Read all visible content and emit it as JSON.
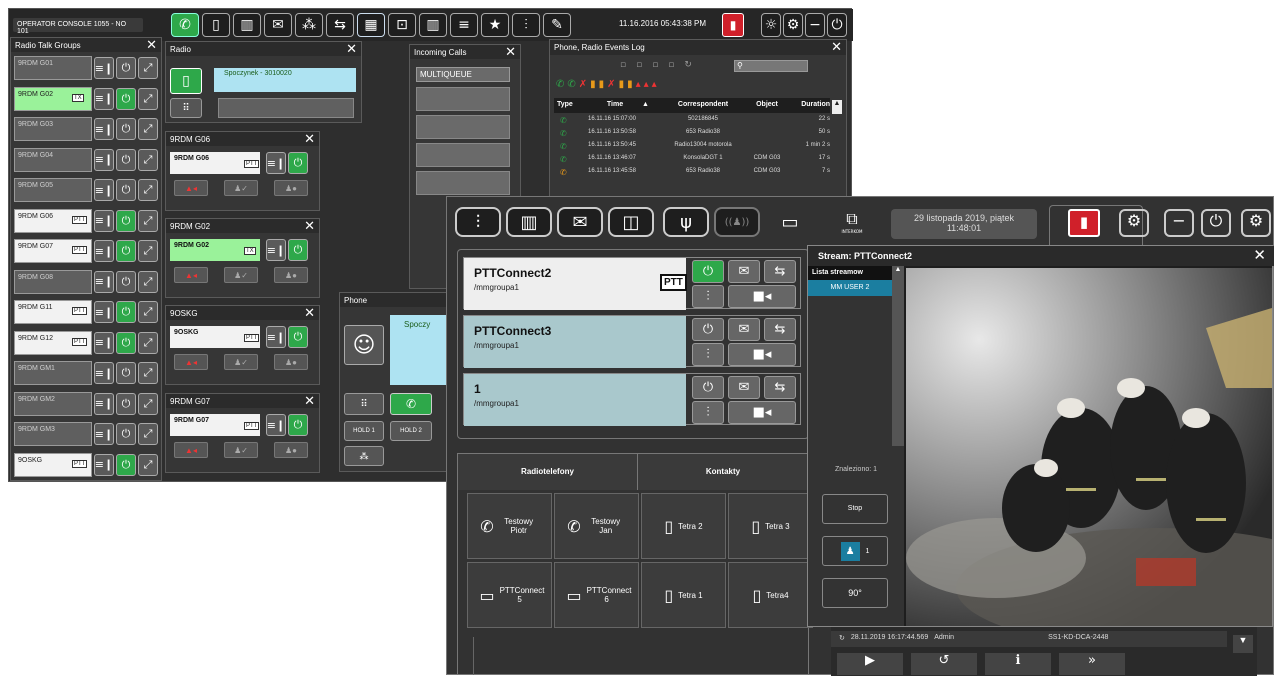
{
  "console": {
    "title": "OPERATOR CONSOLE 1055 - NO 101",
    "clock": "11.16.2016 05:43:38 PM",
    "toolbar_icons": [
      "phone-icon",
      "handset-icon",
      "building-icon",
      "mail-icon",
      "group-icon",
      "transfer-icon",
      "calendar-icon",
      "book-icon",
      "map-icon",
      "stack-icon",
      "star-icon",
      "mixer-icon",
      "wrench-icon"
    ],
    "talk_groups": {
      "title": "Radio Talk Groups",
      "items": [
        {
          "name": "9RDM G01",
          "tag": ""
        },
        {
          "name": "9RDM G02",
          "tag": "TX"
        },
        {
          "name": "9RDM G03",
          "tag": ""
        },
        {
          "name": "9RDM G04",
          "tag": ""
        },
        {
          "name": "9RDM G05",
          "tag": ""
        },
        {
          "name": "9RDM G06",
          "tag": "PTT"
        },
        {
          "name": "9RDM G07",
          "tag": "PTT"
        },
        {
          "name": "9RDM G08",
          "tag": ""
        },
        {
          "name": "9RDM G11",
          "tag": "PTT"
        },
        {
          "name": "9RDM G12",
          "tag": "PTT"
        },
        {
          "name": "9RDM GM1",
          "tag": ""
        },
        {
          "name": "9RDM GM2",
          "tag": ""
        },
        {
          "name": "9RDM GM3",
          "tag": ""
        },
        {
          "name": "9OSKG",
          "tag": "PTT"
        }
      ]
    },
    "radio": {
      "title": "Radio",
      "status": "Spoczynek - 3010020"
    },
    "sub_panels": [
      {
        "title": "9RDM G06",
        "name": "9RDM G06",
        "tag": "PTT"
      },
      {
        "title": "9RDM G02",
        "name": "9RDM G02",
        "tag": "TX"
      },
      {
        "title": "9OSKG",
        "name": "9OSKG",
        "tag": "PTT"
      },
      {
        "title": "9RDM G07",
        "name": "9RDM G07",
        "tag": "PTT"
      }
    ],
    "incoming": {
      "title": "Incoming Calls",
      "queue": "MULTIQUEUE"
    },
    "phone": {
      "title": "Phone",
      "status": "Spoczy",
      "hold1": "HOLD 1",
      "hold2": "HOLD 2"
    },
    "events": {
      "title": "Phone, Radio Events Log",
      "columns": [
        "Type",
        "Time",
        "Correspondent",
        "Object",
        "Duration"
      ],
      "rows": [
        {
          "time": "16.11.16 15:07:00",
          "corr": "502186845",
          "obj": "",
          "dur": "22 s",
          "color": "#2ea84a"
        },
        {
          "time": "16.11.16 13:50:58",
          "corr": "653 Radio38",
          "obj": "",
          "dur": "50 s",
          "color": "#2ea84a"
        },
        {
          "time": "16.11.16 13:50:45",
          "corr": "Radio13004 motorola",
          "obj": "",
          "dur": "1 min 2 s",
          "color": "#2ea84a"
        },
        {
          "time": "16.11.16 13:46:07",
          "corr": "KonsolaDGT 1",
          "obj": "CDM G03",
          "dur": "17 s",
          "color": "#2ea84a"
        },
        {
          "time": "16.11.16 13:45:58",
          "corr": "653 Radio38",
          "obj": "CDM G03",
          "dur": "7 s",
          "color": "#e89a1a"
        }
      ]
    }
  },
  "front": {
    "date": "29 listopada 2019, piątek",
    "time": "11:48:01",
    "intercom": "INTERKOM",
    "cards": [
      {
        "name": "PTTConnect2",
        "group": "/mmgroupa1",
        "ptt": "PTT"
      },
      {
        "name": "PTTConnect3",
        "group": "/mmgroupa1",
        "ptt": ""
      },
      {
        "name": "1",
        "group": "/mmgroupa1",
        "ptt": ""
      }
    ],
    "tabs": [
      "Radiotelefony",
      "Kontakty"
    ],
    "tiles": [
      {
        "label": "Testowy Piotr",
        "icon": "phone"
      },
      {
        "label": "Testowy Jan",
        "icon": "phone"
      },
      {
        "label": "Tetra 2",
        "icon": "radio"
      },
      {
        "label": "Tetra 3",
        "icon": "radio"
      },
      {
        "label": "PTTConnect 5",
        "icon": "ptt"
      },
      {
        "label": "PTTConnect 6",
        "icon": "ptt"
      },
      {
        "label": "Tetra 1",
        "icon": "radio"
      },
      {
        "label": "Tetra4",
        "icon": "radio"
      }
    ],
    "log_rows": [
      {
        "ts": "28.11.2019 16:17:44.569",
        "user": "Admin",
        "obj": "SS1-KD-DCA-2448"
      }
    ],
    "stream": {
      "title": "Stream: PTTConnect2",
      "list_header": "Lista streamow",
      "list_item": "MM USER 2",
      "found": "Znaleziono: 1",
      "stop": "Stop",
      "user_count": "1",
      "rotate": "90°"
    }
  }
}
